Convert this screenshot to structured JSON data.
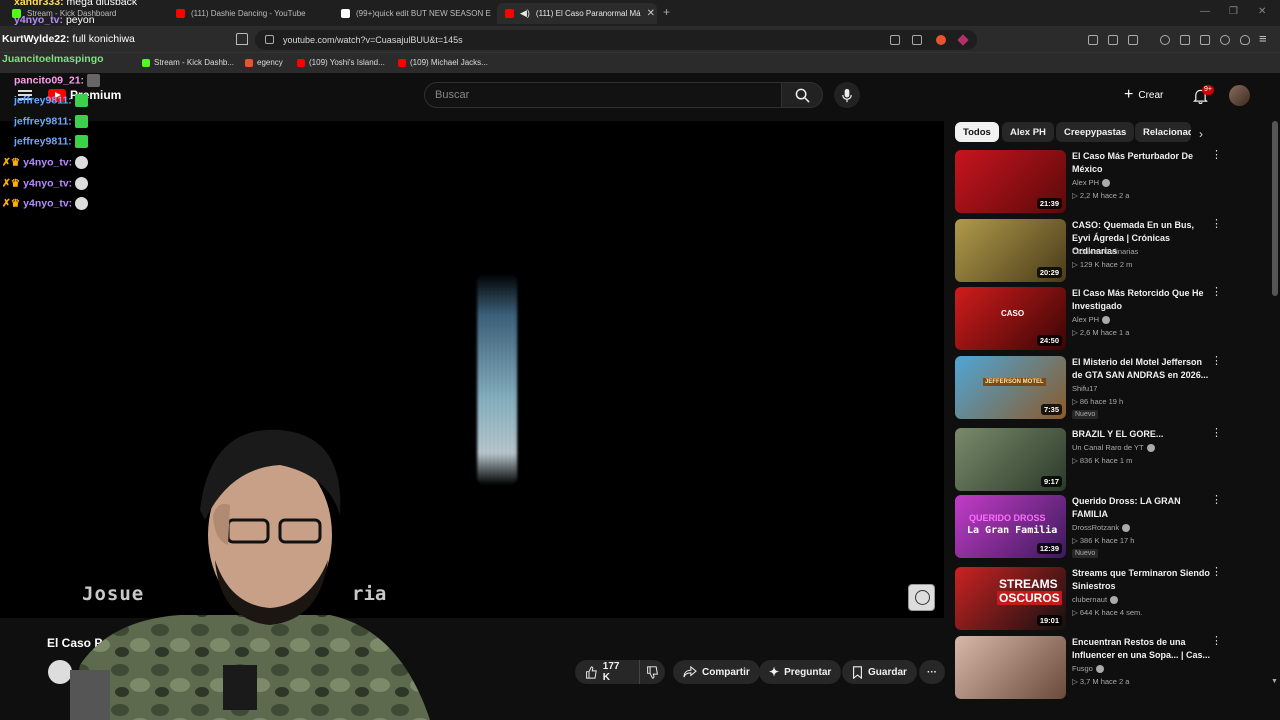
{
  "browser": {
    "tabs": [
      {
        "label": "Stream - Kick Dashboard",
        "color": "#53fc18"
      },
      {
        "label": "(111) Dashie Dancing - YouTube",
        "color": "#ff0000"
      },
      {
        "label": "(99+)quick edit BUT NEW SEASON E",
        "color": "#ffffff"
      },
      {
        "label": "(111) El Caso Paranormal Má",
        "color": "#ff0000"
      }
    ],
    "url": "youtube.com/watch?v=CuasajulBUU&t=145s",
    "bookmarks": [
      {
        "label": "Stream - Kick Dashb...",
        "color": "#53fc18"
      },
      {
        "label": "egency",
        "color": "#e8542f"
      },
      {
        "label": "(109) Yoshi's Island...",
        "color": "#ff0000"
      },
      {
        "label": "(109) Michael Jacks...",
        "color": "#ff0000"
      }
    ]
  },
  "youtube": {
    "logo_text": "Premium",
    "search_placeholder": "Buscar",
    "create_label": "Crear",
    "notification_count": "9+",
    "video": {
      "credit_left": "Josue",
      "credit_right": "ria",
      "title": "El Caso Par",
      "likes": "177 K",
      "share_label": "Compartir",
      "ask_label": "Preguntar",
      "save_label": "Guardar"
    },
    "chips": [
      "Todos",
      "Alex PH",
      "Creepypastas",
      "Relacionad"
    ],
    "recommendations": [
      {
        "title": "El Caso Más Perturbador De México",
        "channel": "Alex PH",
        "verified": true,
        "stats": "2,2 M  hace 2 a",
        "duration": "21:39",
        "new": false,
        "colors": [
          "#c8141e",
          "#5a0a0a"
        ]
      },
      {
        "title": "CASO: Quemada En un Bus, Eyvi Ágreda | Crónicas Ordinarias",
        "channel": "Crónicas Ordinarias",
        "verified": false,
        "stats": "129 K  hace 2 m",
        "duration": "20:29",
        "new": false,
        "colors": [
          "#b09a4a",
          "#4a3b1a"
        ]
      },
      {
        "title": "El Caso Más Retorcido Que He Investigado",
        "channel": "Alex PH",
        "verified": true,
        "stats": "2,6 M  hace 1 a",
        "duration": "24:50",
        "new": false,
        "colors": [
          "#d01c1c",
          "#3a0505"
        ]
      },
      {
        "title": "El Misterio del Motel Jefferson de GTA SAN ANDRAS en 2026...",
        "channel": "Shifu17",
        "verified": false,
        "stats": "86  hace 19 h",
        "duration": "7:35",
        "new": true,
        "colors": [
          "#4fa6d6",
          "#8a5a2a"
        ]
      },
      {
        "title": "BRAZIL Y EL GORE...",
        "channel": "Un Canal Raro de YT",
        "verified": true,
        "stats": "836 K  hace 1 m",
        "duration": "9:17",
        "new": false,
        "colors": [
          "#7a8a6a",
          "#2a3a2a"
        ]
      },
      {
        "title": "Querido Dross: LA GRAN FAMILIA",
        "channel": "DrossRotzank",
        "verified": true,
        "stats": "386 K  hace 17 h",
        "duration": "12:39",
        "new": true,
        "colors": [
          "#c43cc8",
          "#3a1a5a"
        ]
      },
      {
        "title": "Streams que Terminaron Siendo Siniestros",
        "channel": "clubernaut",
        "verified": true,
        "stats": "644 K  hace 4 sem.",
        "duration": "19:01",
        "new": false,
        "colors": [
          "#cc2222",
          "#111111"
        ]
      },
      {
        "title": "Encuentran Restos de una Influencer en una Sopa... | Cas...",
        "channel": "Fusgo",
        "verified": true,
        "stats": "3,7 M  hace 2 a",
        "duration": "",
        "new": false,
        "colors": [
          "#d8b8a8",
          "#6a4a3a"
        ]
      }
    ],
    "thumb_texts": {
      "t3": "CASO",
      "t4": "JEFFERSON MOTEL",
      "t6": "La Gran Familia",
      "t6b": "QUERIDO DROSS",
      "t7a": "STREAMS",
      "t7b": "OSCUROS"
    }
  },
  "chat": [
    {
      "user": "xandr333",
      "msg": "mega diusback",
      "color": "#ffdd55"
    },
    {
      "user": "y4nyo_tv",
      "msg": "peyon",
      "color": "#b58cff"
    },
    {
      "user": "KurtWylde22",
      "msg": "full konichiwa",
      "color": "#ffffff"
    },
    {
      "user": "Juancitoelmaspingo",
      "msg": "",
      "color": "#7ee07e"
    },
    {
      "user": "pancito09_21",
      "msg": "",
      "color": "#ff9cf0"
    },
    {
      "user": "jeffrey9811",
      "msg": "",
      "color": "#6aa8ff"
    },
    {
      "user": "jeffrey9811",
      "msg": "",
      "color": "#6aa8ff"
    },
    {
      "user": "jeffrey9811",
      "msg": "",
      "color": "#6aa8ff"
    },
    {
      "user": "y4nyo_tv",
      "msg": "",
      "color": "#b58cff"
    },
    {
      "user": "y4nyo_tv",
      "msg": "",
      "color": "#b58cff"
    },
    {
      "user": "y4nyo_tv",
      "msg": "",
      "color": "#b58cff"
    }
  ]
}
